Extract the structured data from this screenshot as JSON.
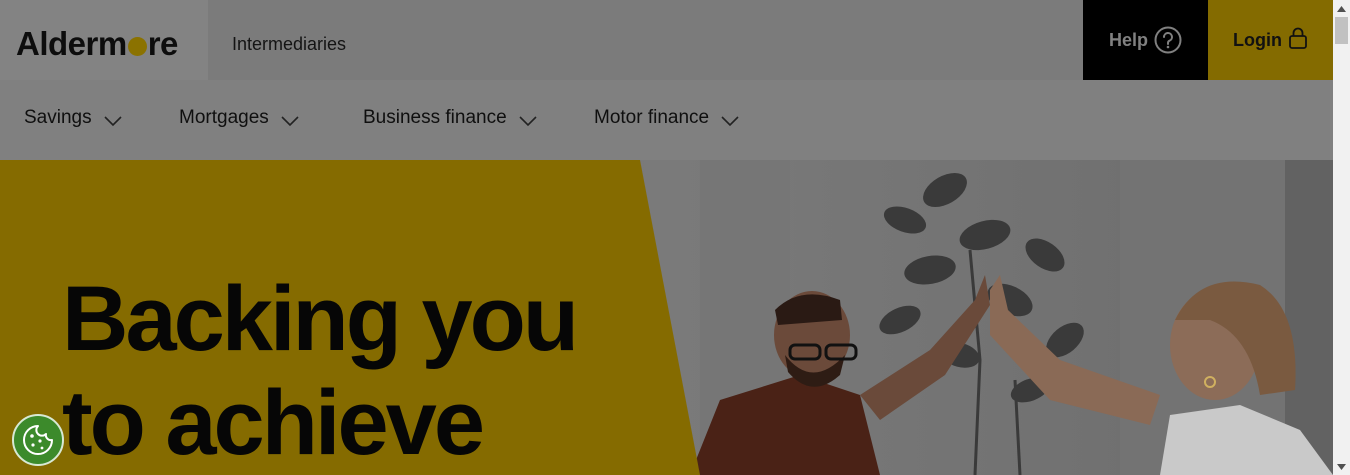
{
  "header": {
    "logo_left": "Alderm",
    "logo_right": "re",
    "intermediaries_link": "Intermediaries",
    "help_label": "Help",
    "login_label": "Login"
  },
  "nav": {
    "items": [
      {
        "label": "Savings"
      },
      {
        "label": "Mortgages"
      },
      {
        "label": "Business finance"
      },
      {
        "label": "Motor finance"
      }
    ]
  },
  "hero": {
    "headline": "Backing you\nto achieve",
    "image_alt": "Two people high-fiving in front of a plant"
  },
  "colors": {
    "brand_yellow": "#856b00",
    "help_bg": "#000000",
    "cookie_green": "#3c8a2b"
  },
  "icons": {
    "help": "question-circle-icon",
    "login": "padlock-icon",
    "nav_chevron": "chevron-down-icon",
    "cookie": "cookie-icon"
  }
}
